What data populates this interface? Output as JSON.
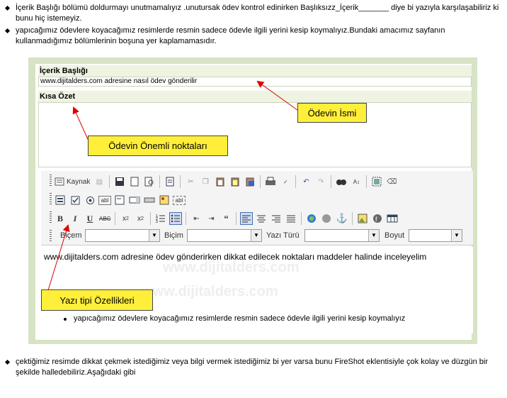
{
  "top_bullets": [
    "İçerik Başlığı bölümü doldurmayı unutmamalıyız .unutursak  ödev kontrol edinirken   Başlıksızz_İçerik_______  diye bi yazıyla karşılaşabiliriz ki bunu hiç istemeyiz.",
    "yapıcağımız ödevlere koyacağımız resimlerde resmin sadece ödevle ilgili yerini kesip koymalıyız.Bundaki amacımız sayfanın kullanmadığımız bölümlerinin boşuna yer kaplamamasıdır."
  ],
  "form": {
    "title_label": "İçerik Başlığı",
    "title_value": "www.dijitalders.com adresine nasıl ödev gönderilir",
    "summary_label": "Kısa Özet"
  },
  "toolbar": {
    "source_label": "Kaynak",
    "abc_label": "ABC",
    "combo_labels": [
      "Biçem",
      "Biçim",
      "Yazı Türü",
      "Boyut"
    ]
  },
  "editor": {
    "body_text": "www.dijitalders.com  adresine ödev gönderirken dikkat edilecek noktaları maddeler halinde inceleyelim",
    "list_item": "yapıcağımız ödevlere koyacağımız resimlerde resmin sadece ödevle ilgili yerini kesip koymalıyız",
    "watermark": [
      "www.dijitalders.com",
      "www.dijitalders.com"
    ]
  },
  "callouts": {
    "odev_ismi": "Ödevin İsmi",
    "onemli": "Ödevin Önemli noktaları",
    "yazi_tipi": "Yazı tipi Özellikleri"
  },
  "bottom_bullet": "çektiğimiz resimde dikkat çekmek istediğimiz veya bilgi vermek istediğimiz bi yer varsa bunu  FireShot eklentisiyle çok kolay ve düzgün bir şekilde halledebiliriz.Aşağıdaki gibi",
  "colors": {
    "callout": "#ffef3a",
    "arrow": "#e00000",
    "frame": "#d6e3c4"
  }
}
